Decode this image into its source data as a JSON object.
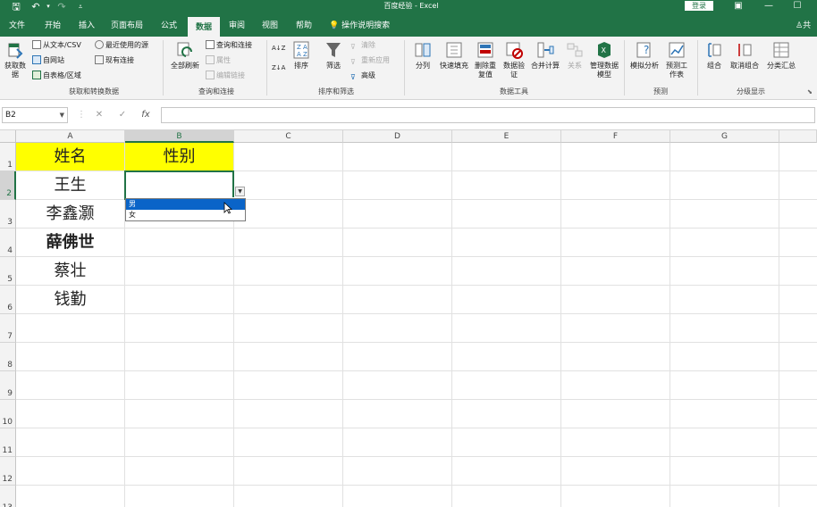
{
  "window": {
    "title": "百度经验  -  Excel",
    "login_label": "登录",
    "share_label": "共",
    "quick_access": {
      "save": "save-icon",
      "undo": "undo-icon",
      "redo": "redo-icon",
      "customize": "customize-icon"
    }
  },
  "tabs": [
    "文件",
    "开始",
    "插入",
    "页面布局",
    "公式",
    "数据",
    "审阅",
    "视图",
    "帮助"
  ],
  "active_tab": "数据",
  "tell_me": "操作说明搜索",
  "ribbon": {
    "get_transform": {
      "label": "获取和转换数据",
      "get_data": "获取数据",
      "from_text": "从文本/CSV",
      "from_web": "自网站",
      "from_table": "自表格/区域",
      "recent_sources": "最近使用的源",
      "existing_conn": "现有连接"
    },
    "queries": {
      "label": "查询和连接",
      "refresh_all": "全部刷新",
      "queries_conn": "查询和连接",
      "properties": "属性",
      "edit_links": "编辑链接"
    },
    "sort_filter": {
      "label": "排序和筛选",
      "sort": "排序",
      "filter": "筛选",
      "clear": "清除",
      "reapply": "重新应用",
      "advanced": "高级"
    },
    "data_tools": {
      "label": "数据工具",
      "text_to_columns": "分列",
      "flash_fill": "快速填充",
      "remove_dup": "删除重复值",
      "validation": "数据验证",
      "consolidate": "合并计算",
      "relations": "关系",
      "manage_model": "管理数据模型"
    },
    "forecast": {
      "label": "预测",
      "what_if": "模拟分析",
      "forecast_sheet": "预测工作表"
    },
    "outline": {
      "label": "分级显示",
      "group": "组合",
      "ungroup": "取消组合",
      "subtotal": "分类汇总"
    }
  },
  "formula_bar": {
    "name_box": "B2",
    "content": ""
  },
  "columns": [
    "A",
    "B",
    "C",
    "D",
    "E",
    "F",
    "G"
  ],
  "rows": [
    "1",
    "2",
    "3",
    "4",
    "5",
    "6",
    "7",
    "8",
    "9",
    "10",
    "11",
    "12",
    "13"
  ],
  "cells": {
    "A1": "姓名",
    "B1": "性别",
    "A2": "王生",
    "A3": "李鑫灏",
    "A4": "薛佛世",
    "A5": "蔡壮",
    "A6": "钱勤"
  },
  "dropdown": {
    "options": [
      "男",
      "女"
    ],
    "highlighted": "男"
  },
  "colors": {
    "excel_green": "#217346",
    "header_fill": "#ffff00",
    "highlight": "#0a64c8"
  }
}
